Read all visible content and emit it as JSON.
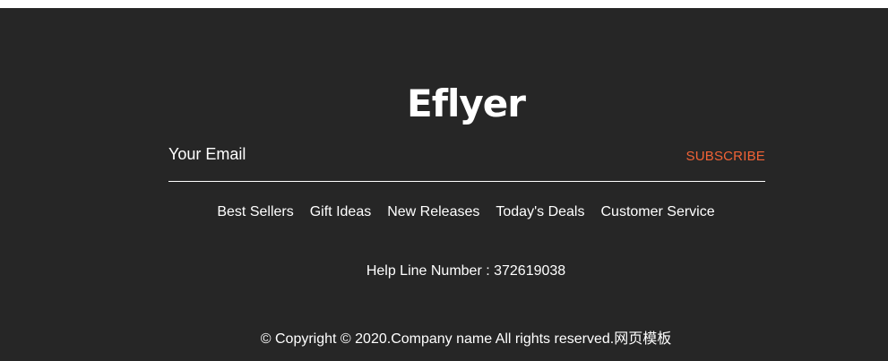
{
  "brand": {
    "name": "Eflyer"
  },
  "newsletter": {
    "email_placeholder": "Your Email",
    "email_value": "",
    "subscribe_label": "SUBSCRIBE"
  },
  "nav": {
    "items": [
      {
        "label": "Best Sellers"
      },
      {
        "label": "Gift Ideas"
      },
      {
        "label": "New Releases"
      },
      {
        "label": "Today's Deals"
      },
      {
        "label": "Customer Service"
      }
    ]
  },
  "helpline": {
    "text": "Help Line Number : 372619038"
  },
  "copyright": {
    "text": "© Copyright © 2020.Company name All rights reserved.",
    "link_label": "网页模板"
  },
  "colors": {
    "background": "#262626",
    "text": "#ffffff",
    "accent": "#f26336"
  }
}
